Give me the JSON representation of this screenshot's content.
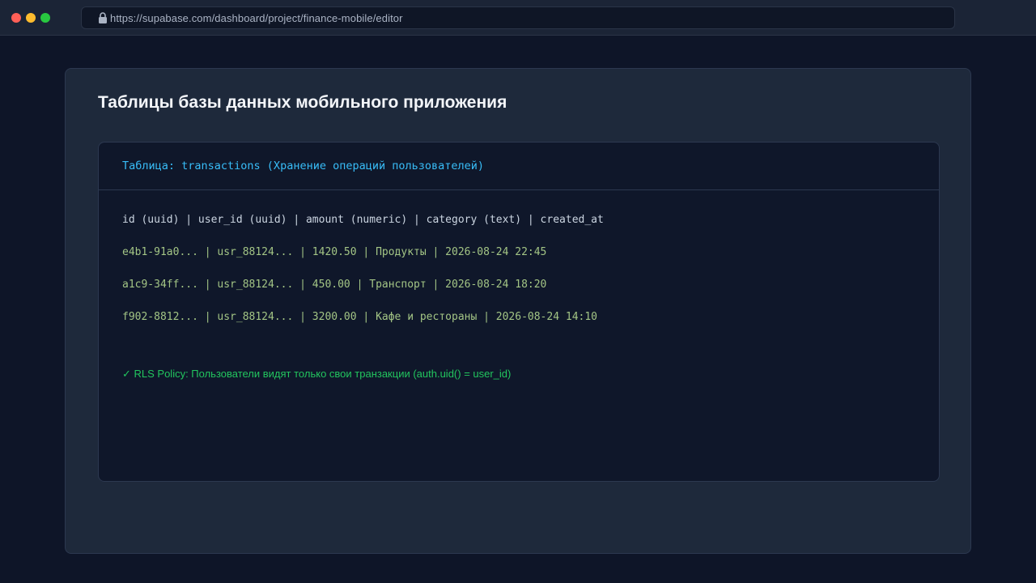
{
  "browser": {
    "url": "https://supabase.com/dashboard/project/finance-mobile/editor",
    "lock_icon": "lock-icon"
  },
  "page": {
    "title": "Таблицы базы данных мобильного приложения"
  },
  "table_card": {
    "title": "Таблица: transactions (Хранение операций пользователей)",
    "schema": "id (uuid) | user_id (uuid) | amount (numeric) | category (text) | created_at",
    "rows": [
      "e4b1-91a0... | usr_88124... | 1420.50 | Продукты | 2026-08-24 22:45",
      "a1c9-34ff... | usr_88124... | 450.00 | Транспорт | 2026-08-24 18:20",
      "f902-8812... | usr_88124... | 3200.00 | Кафе и рестораны | 2026-08-24 14:10"
    ],
    "policy": "✓ RLS Policy: Пользователи видят только свои транзакции (auth.uid() = user_id)"
  },
  "colors": {
    "background": "#0e1528",
    "panel": "#1e293b",
    "card": "#0f172a",
    "accent_blue": "#38bdf8",
    "data_green": "#a3c585",
    "policy_green": "#22c55e"
  }
}
